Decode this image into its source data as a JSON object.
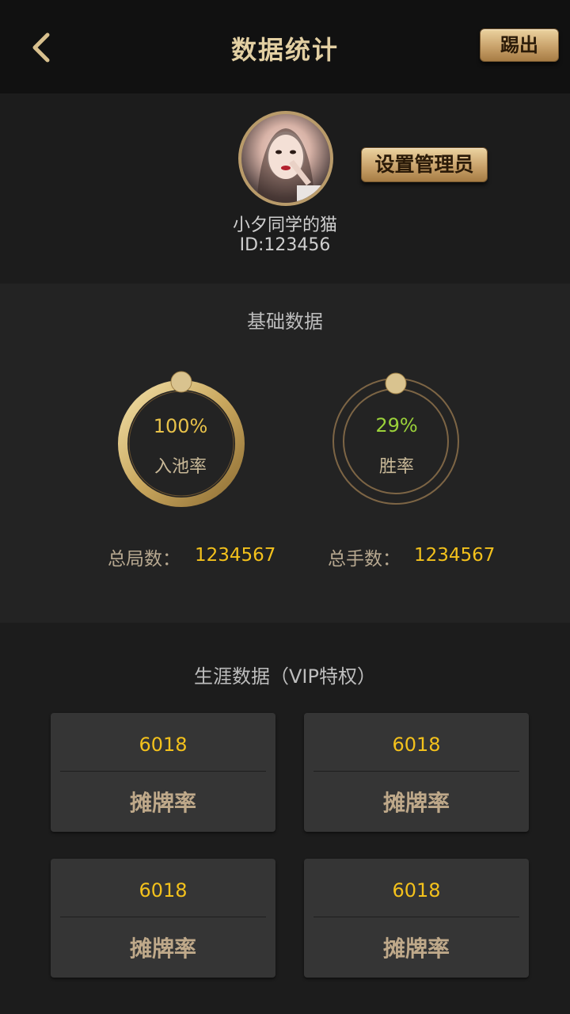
{
  "header": {
    "title": "数据统计",
    "kick_label": "踢出"
  },
  "profile": {
    "admin_label": "设置管理员",
    "username": "小夕同学的猫",
    "id_text": "ID:123456"
  },
  "basic": {
    "title": "基础数据",
    "rings": [
      {
        "value": "100%",
        "label": "入池率",
        "value_color": "#e8c24a"
      },
      {
        "value": "29%",
        "label": "胜率",
        "value_color": "#9bd23a"
      }
    ],
    "total_games_label": "总局数：",
    "total_games_value": "1234567",
    "total_hands_label": "总手数：",
    "total_hands_value": "1234567"
  },
  "career": {
    "title": "生涯数据（VIP特权）",
    "cards": [
      {
        "value": "6018",
        "label": "摊牌率"
      },
      {
        "value": "6018",
        "label": "摊牌率"
      },
      {
        "value": "6018",
        "label": "摊牌率"
      },
      {
        "value": "6018",
        "label": "摊牌率"
      }
    ]
  },
  "icons": {
    "back": "chevron-left-icon"
  },
  "colors": {
    "accent_gold": "#c9a26b",
    "value_yellow": "#f3c11c",
    "win_green": "#9bd23a"
  }
}
